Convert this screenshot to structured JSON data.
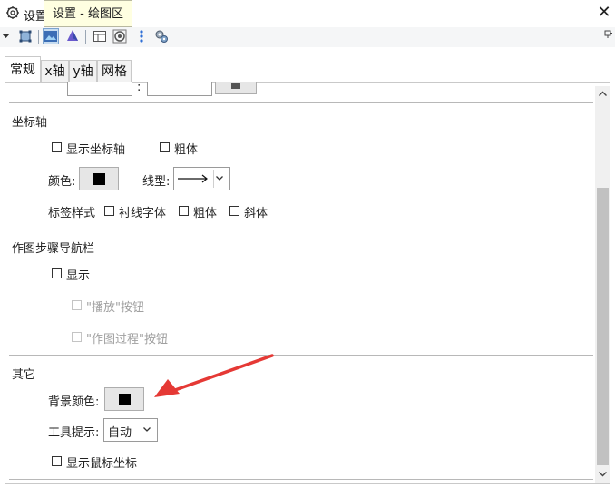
{
  "window": {
    "title_fragment": "设置",
    "tooltip": "设置 - 绘图区",
    "close_glyph": "✕"
  },
  "tabs": [
    {
      "label": "常规",
      "active": true
    },
    {
      "label": "x轴",
      "active": false
    },
    {
      "label": "y轴",
      "active": false
    },
    {
      "label": "网格",
      "active": false
    }
  ],
  "top_row": {
    "separator": ":"
  },
  "axes_section": {
    "title": "坐标轴",
    "show_axes": {
      "label": "显示坐标轴",
      "checked": false
    },
    "bold": {
      "label": "粗体",
      "checked": false
    },
    "color_label": "颜色:",
    "color_value": "#000000",
    "line_type_label": "线型:",
    "label_style": "标签样式",
    "serif": {
      "label": "衬线字体",
      "checked": false
    },
    "label_bold": {
      "label": "粗体",
      "checked": false
    },
    "italic": {
      "label": "斜体",
      "checked": false
    }
  },
  "nav_section": {
    "title": "作图步骤导航栏",
    "show": {
      "label": "显示",
      "checked": false
    },
    "play_button": {
      "label": "\"播放\"按钮",
      "checked": false,
      "disabled": true
    },
    "construction_button": {
      "label": "\"作图过程\"按钮",
      "checked": false,
      "disabled": true
    }
  },
  "other_section": {
    "title": "其它",
    "bg_color_label": "背景颜色:",
    "bg_color_value": "#000000",
    "tooltips_label": "工具提示:",
    "tooltips_value": "自动",
    "show_mouse_coords": {
      "label": "显示鼠标坐标",
      "checked": false
    }
  },
  "colors": {
    "annotation_arrow": "#e53935",
    "scroll_thumb": "#c1c1c1"
  },
  "scrollbar": {
    "up_glyph": "^",
    "down_glyph": "v"
  }
}
